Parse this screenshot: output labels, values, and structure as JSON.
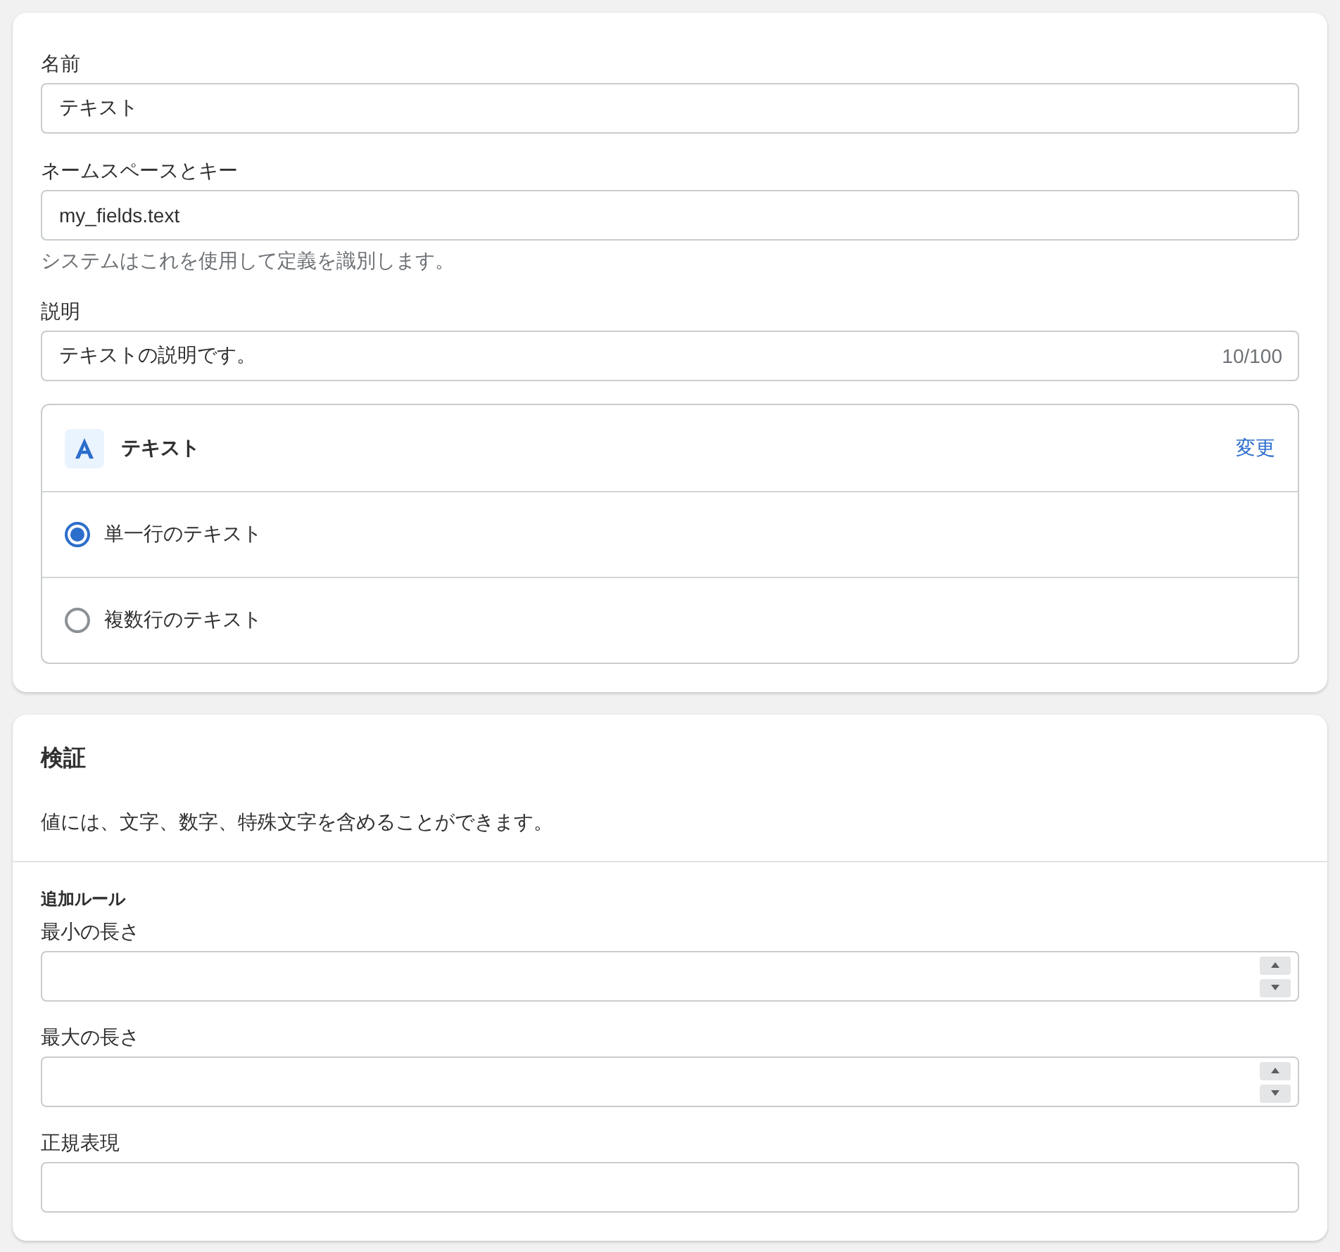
{
  "definition": {
    "fields": [
      {
        "kind": "text",
        "label": "名前",
        "value": "テキスト"
      },
      {
        "kind": "text",
        "label": "ネームスペースとキー",
        "value": "my_fields.text",
        "help": "システムはこれを使用して定義を識別します。"
      },
      {
        "kind": "counted",
        "label": "説明",
        "value": "テキストの説明です。",
        "counter": "10/100"
      }
    ],
    "type_box": {
      "title": "テキスト",
      "action": "変更",
      "options": [
        {
          "label": "単一行のテキスト",
          "selected": true
        },
        {
          "label": "複数行のテキスト",
          "selected": false
        }
      ]
    }
  },
  "validation": {
    "title": "検証",
    "description": "値には、文字、数字、特殊文字を含めることができます。",
    "rules_heading": "追加ルール",
    "rules": [
      {
        "kind": "number",
        "label": "最小の長さ"
      },
      {
        "kind": "number",
        "label": "最大の長さ"
      },
      {
        "kind": "text",
        "label": "正規表現"
      }
    ]
  }
}
